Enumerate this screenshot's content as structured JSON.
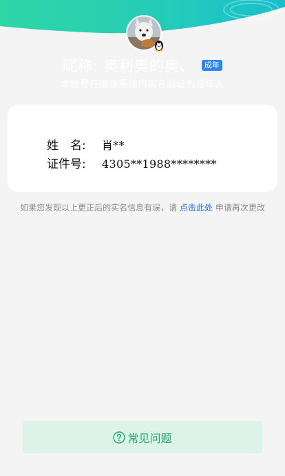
{
  "theme": {
    "header_gradient_start": "#2fd2a9",
    "header_gradient_end": "#1ac0c9",
    "accent_blue": "#2b86f0",
    "link_blue": "#2b6fd6",
    "faq_green": "#1ea86e",
    "faq_bg": "#dcf3e9"
  },
  "profile": {
    "avatar_icon": "dog-avatar-photo",
    "badge_icon": "qq-penguin-icon",
    "nickname": "昵称: 奥利奥的奥、",
    "age_badge": "成年",
    "verify_note": "本帐号在健康系统内实名验证为成年人"
  },
  "identity_card": {
    "name_label": "姓　名:",
    "name_value": "肖**",
    "id_label": "证件号:",
    "id_value": "4305**1988********"
  },
  "correction": {
    "prefix": "如果您发现以上更正后的实名信息有误，请",
    "link": "点击此处",
    "suffix": "申请再次更改"
  },
  "faq": {
    "icon": "question-circle-icon",
    "label": "常见问题"
  }
}
